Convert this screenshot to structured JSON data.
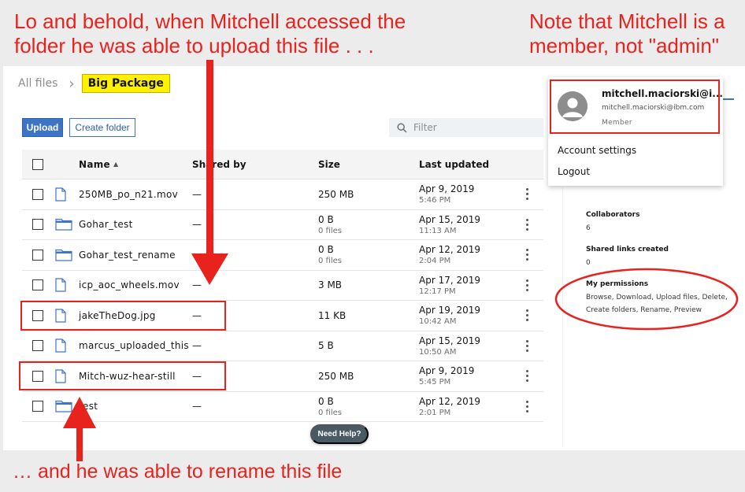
{
  "annotations": {
    "top_left_line1": "Lo and behold, when Mitchell accessed the",
    "top_left_line2": "folder he was able to upload this file . . .",
    "top_right_line1": "Note that Mitchell is a",
    "top_right_line2": "member, not \"admin\"",
    "bottom": "… and he was able to rename this file"
  },
  "breadcrumb": {
    "root": "All files",
    "separator": "›",
    "current": "Big Package"
  },
  "toolbar": {
    "upload_label": "Upload",
    "create_folder_label": "Create folder",
    "filter_placeholder": "Filter"
  },
  "table": {
    "headers": {
      "name": "Name",
      "shared_by": "Shared by",
      "size": "Size",
      "last_updated": "Last updated"
    },
    "rows": [
      {
        "type": "file",
        "name": "250MB_po_n21.mov",
        "shared_by": "—",
        "size": "250 MB",
        "size_sub": "",
        "date": "Apr 9, 2019",
        "time": "5:46 PM"
      },
      {
        "type": "folder",
        "name": "Gohar_test",
        "shared_by": "—",
        "size": "0 B",
        "size_sub": "0 files",
        "date": "Apr 15, 2019",
        "time": "11:13 AM"
      },
      {
        "type": "folder",
        "name": "Gohar_test_rename",
        "shared_by": "—",
        "size": "0 B",
        "size_sub": "0 files",
        "date": "Apr 12, 2019",
        "time": "2:04 PM"
      },
      {
        "type": "file",
        "name": "icp_aoc_wheels.mov",
        "shared_by": "—",
        "size": "3 MB",
        "size_sub": "",
        "date": "Apr 17, 2019",
        "time": "12:17 PM"
      },
      {
        "type": "file",
        "name": "jakeTheDog.jpg",
        "shared_by": "—",
        "size": "11 KB",
        "size_sub": "",
        "date": "Apr 19, 2019",
        "time": "10:42 AM"
      },
      {
        "type": "file",
        "name": "marcus_uploaded_this",
        "shared_by": "—",
        "size": "5 B",
        "size_sub": "",
        "date": "Apr 15, 2019",
        "time": "10:50 AM"
      },
      {
        "type": "file",
        "name": "Mitch-wuz-hear-still",
        "shared_by": "—",
        "size": "250 MB",
        "size_sub": "",
        "date": "Apr 9, 2019",
        "time": "5:45 PM"
      },
      {
        "type": "folder",
        "name": "test",
        "shared_by": "—",
        "size": "0 B",
        "size_sub": "0 files",
        "date": "Apr 12, 2019",
        "time": "2:01 PM"
      }
    ]
  },
  "account": {
    "name": "mitchell.maciorski@i...",
    "email": "mitchell.maciorski@ibm.com",
    "role": "Member",
    "menu": [
      "Account settings",
      "Logout"
    ]
  },
  "details": {
    "collaborators_label": "Collaborators",
    "collaborators_value": "6",
    "shared_links_label": "Shared links created",
    "shared_links_value": "0",
    "permissions_label": "My permissions",
    "permissions_line1": "Browse, Download, Upload files, Delete,",
    "permissions_line2": "Create folders, Rename, Preview"
  },
  "help": {
    "label": "Need Help?"
  },
  "colors": {
    "annotation_red": "#e8221d",
    "highlight_yellow": "#fff200",
    "primary_blue": "#3e74c6"
  },
  "icons": {
    "file": "file-icon",
    "folder": "folder-icon",
    "search": "search-icon",
    "user": "user-avatar-icon",
    "overflow": "overflow-menu-icon",
    "sort": "sort-ascending-icon"
  }
}
